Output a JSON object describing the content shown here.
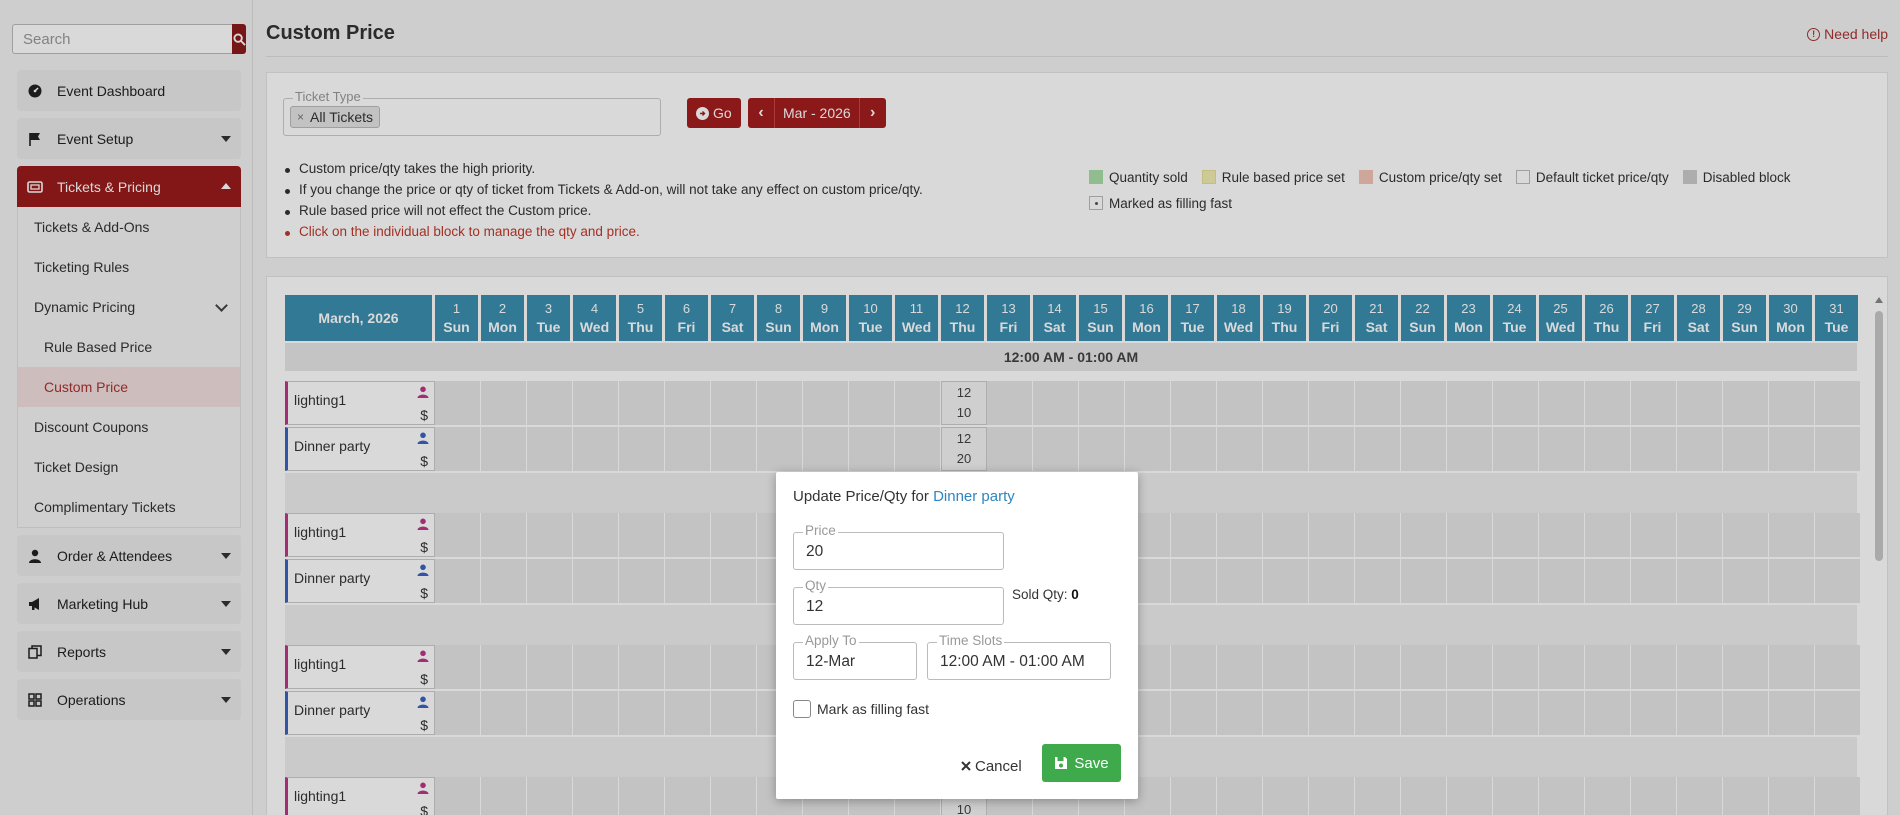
{
  "search": {
    "placeholder": "Search"
  },
  "sidebar": {
    "items": [
      {
        "label": "Event Dashboard"
      },
      {
        "label": "Event Setup"
      },
      {
        "label": "Tickets & Pricing"
      },
      {
        "label": "Order & Attendees"
      },
      {
        "label": "Marketing Hub"
      },
      {
        "label": "Reports"
      },
      {
        "label": "Operations"
      }
    ],
    "sub_items": {
      "tickets_addons": "Tickets & Add-Ons",
      "ticketing_rules": "Ticketing Rules",
      "dynamic_pricing": "Dynamic Pricing",
      "rule_based_price": "Rule Based Price",
      "custom_price": "Custom Price",
      "discount_coupons": "Discount Coupons",
      "ticket_design": "Ticket Design",
      "complimentary_tickets": "Complimentary Tickets"
    }
  },
  "header": {
    "title": "Custom Price",
    "help": "Need help"
  },
  "filters": {
    "ticket_type_label": "Ticket Type",
    "ticket_type_chip": "All Tickets",
    "go_label": "Go",
    "month_label": "Mar - 2026"
  },
  "notes": [
    "Custom price/qty takes the high priority.",
    "If you change the price or qty of ticket from Tickets & Add-on, will not take any effect on custom price/qty.",
    "Rule based price will not effect the Custom price.",
    "Click on the individual block to manage the qty and price."
  ],
  "legend": [
    {
      "label": "Quantity sold",
      "color": "#a9dfa9"
    },
    {
      "label": "Rule based price set",
      "color": "#f3eeb0"
    },
    {
      "label": "Custom price/qty set",
      "color": "#f2c4b6"
    },
    {
      "label": "Default ticket price/qty",
      "color": "#ffffff"
    },
    {
      "label": "Disabled block",
      "color": "#cccccc"
    },
    {
      "label": "Marked as filling fast",
      "color": "#ffffff"
    }
  ],
  "calendar": {
    "month_heading": "March, 2026",
    "days": [
      {
        "d": "1",
        "w": "Sun"
      },
      {
        "d": "2",
        "w": "Mon"
      },
      {
        "d": "3",
        "w": "Tue"
      },
      {
        "d": "4",
        "w": "Wed"
      },
      {
        "d": "5",
        "w": "Thu"
      },
      {
        "d": "6",
        "w": "Fri"
      },
      {
        "d": "7",
        "w": "Sat"
      },
      {
        "d": "8",
        "w": "Sun"
      },
      {
        "d": "9",
        "w": "Mon"
      },
      {
        "d": "10",
        "w": "Tue"
      },
      {
        "d": "11",
        "w": "Wed"
      },
      {
        "d": "12",
        "w": "Thu"
      },
      {
        "d": "13",
        "w": "Fri"
      },
      {
        "d": "14",
        "w": "Sat"
      },
      {
        "d": "15",
        "w": "Sun"
      },
      {
        "d": "16",
        "w": "Mon"
      },
      {
        "d": "17",
        "w": "Tue"
      },
      {
        "d": "18",
        "w": "Wed"
      },
      {
        "d": "19",
        "w": "Thu"
      },
      {
        "d": "20",
        "w": "Fri"
      },
      {
        "d": "21",
        "w": "Sat"
      },
      {
        "d": "22",
        "w": "Sun"
      },
      {
        "d": "23",
        "w": "Mon"
      },
      {
        "d": "24",
        "w": "Tue"
      },
      {
        "d": "25",
        "w": "Wed"
      },
      {
        "d": "26",
        "w": "Thu"
      },
      {
        "d": "27",
        "w": "Fri"
      },
      {
        "d": "28",
        "w": "Sat"
      },
      {
        "d": "29",
        "w": "Sun"
      },
      {
        "d": "30",
        "w": "Mon"
      },
      {
        "d": "31",
        "w": "Tue"
      }
    ],
    "time_slot": "12:00 AM - 01:00 AM",
    "rows": [
      {
        "ticket": "lighting1",
        "set_qty": "12",
        "set_price": "10"
      },
      {
        "ticket": "Dinner party",
        "set_qty": "12",
        "set_price": "20"
      },
      {
        "ticket": "lighting1"
      },
      {
        "ticket": "Dinner party"
      },
      {
        "ticket": "lighting1"
      },
      {
        "ticket": "Dinner party"
      },
      {
        "ticket": "lighting1",
        "partial_value": "10"
      }
    ]
  },
  "modal": {
    "title_prefix": "Update Price/Qty for",
    "title_ticket": "Dinner party",
    "price_label": "Price",
    "price_value": "20",
    "qty_label": "Qty",
    "qty_value": "12",
    "sold_label": "Sold Qty:",
    "sold_value": "0",
    "apply_label": "Apply To",
    "apply_value": "12-Mar",
    "slots_label": "Time Slots",
    "slots_value": "12:00 AM - 01:00 AM",
    "filling_fast_label": "Mark as filling fast",
    "cancel_label": "Cancel",
    "save_label": "Save"
  }
}
